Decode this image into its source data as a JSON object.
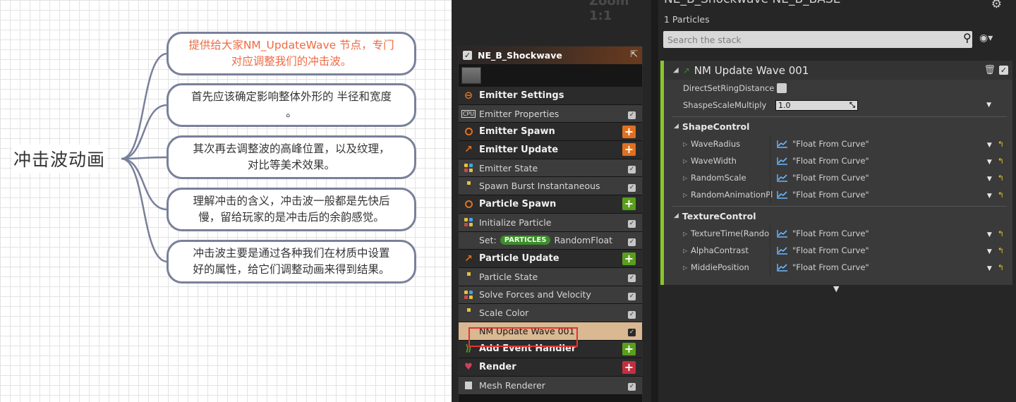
{
  "mindmap": {
    "root": "冲击波动画",
    "nodes": [
      {
        "line1": "提供给大家NM_UpdateWave 节点，专门",
        "line2": "对应调整我们的冲击波。"
      },
      {
        "line1": "首先应该确定影响整体外形的 半径和宽度",
        "line2": "。"
      },
      {
        "line1": "其次再去调整波的高峰位置，以及纹理，",
        "line2": "对比等美术效果。"
      },
      {
        "line1": "理解冲击的含义，冲击波一般都是先快后",
        "line2": "慢，留给玩家的是冲击后的余韵感觉。"
      },
      {
        "line1": "冲击波主要是通过各种我们在材质中设置",
        "line2": "好的属性，给它们调整动画来得到结果。"
      }
    ],
    "colors": {
      "highlight": "#ef6a43",
      "border": "#79809a"
    }
  },
  "emitter": {
    "title": "NE_B_Shockwave",
    "rows": [
      {
        "label": "Emitter Settings",
        "kind": "section",
        "icon": "emitter-settings-icon"
      },
      {
        "label": "Emitter Properties",
        "kind": "module",
        "icon": "cpu-icon"
      },
      {
        "label": "Emitter Spawn",
        "kind": "section",
        "icon": "spawn-ring-icon",
        "action": "add-orange"
      },
      {
        "label": "Emitter Update",
        "kind": "section",
        "icon": "update-arrow-icon",
        "action": "add-orange"
      },
      {
        "label": "Emitter State",
        "kind": "module",
        "icon": "dots-icon"
      },
      {
        "label": "Spawn Burst Instantaneous",
        "kind": "module",
        "icon": "dot-icon"
      },
      {
        "label": "Particle Spawn",
        "kind": "section",
        "icon": "spawn-ring-icon",
        "action": "add-green"
      },
      {
        "label": "Initialize Particle",
        "kind": "module",
        "icon": "dots-icon"
      },
      {
        "label": "Set:",
        "pill": "PARTICLES",
        "label2": "RandomFloat",
        "kind": "module",
        "icon": "none"
      },
      {
        "label": "Particle Update",
        "kind": "section",
        "icon": "update-arrow-icon",
        "action": "add-green"
      },
      {
        "label": "Particle State",
        "kind": "module",
        "icon": "dot-icon"
      },
      {
        "label": "Solve Forces and Velocity",
        "kind": "module",
        "icon": "dots-icon"
      },
      {
        "label": "Scale Color",
        "kind": "module",
        "icon": "dot-icon"
      },
      {
        "label": "NM Update Wave 001",
        "kind": "selected",
        "icon": "none"
      },
      {
        "label": "Add Event Handler",
        "kind": "section",
        "icon": "event-icon",
        "action": "add-green"
      },
      {
        "label": "Render",
        "kind": "section",
        "icon": "render-icon",
        "action": "add-red"
      },
      {
        "label": "Mesh Renderer",
        "kind": "module",
        "icon": "mesh-icon"
      }
    ]
  },
  "details": {
    "top_title": "NE_B_Shockwave NE_B_BASE",
    "particles": "1 Particles",
    "search_placeholder": "Search the stack",
    "module_title": "NM Update Wave 001",
    "params_top": [
      {
        "name": "DirectSetRingDistance",
        "type": "bool"
      },
      {
        "name": "ShaspeScaleMultiply",
        "type": "float",
        "value": "1.0"
      }
    ],
    "groups": [
      {
        "title": "ShapeControl",
        "params": [
          {
            "name": "WaveRadius",
            "value": "\"Float From Curve\""
          },
          {
            "name": "WaveWidth",
            "value": "\"Float From Curve\""
          },
          {
            "name": "RandomScale",
            "value": "\"Float From Curve\""
          },
          {
            "name": "RandomAnimationPl",
            "value": "\"Float From Curve\""
          }
        ]
      },
      {
        "title": "TextureControl",
        "params": [
          {
            "name": "TextureTime(Rando",
            "value": "\"Float From Curve\""
          },
          {
            "name": "AlphaContrast",
            "value": "\"Float From Curve\""
          },
          {
            "name": "MiddiePosition",
            "value": "\"Float From Curve\""
          }
        ]
      }
    ],
    "accent": "#8bc52a"
  }
}
